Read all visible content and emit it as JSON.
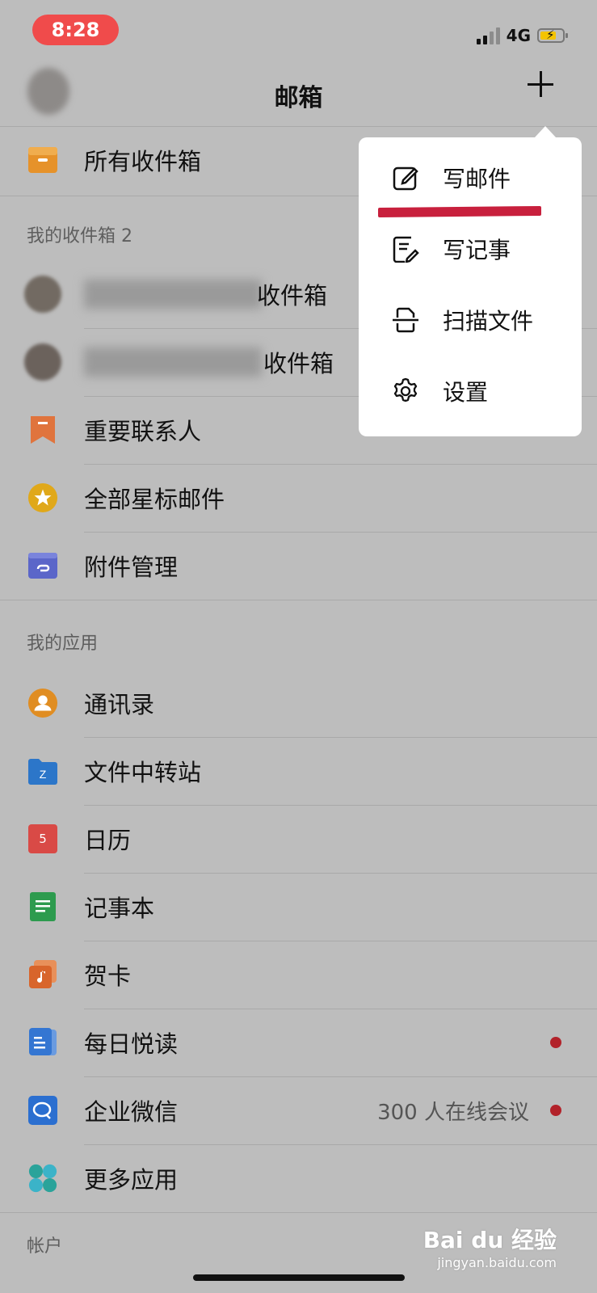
{
  "status": {
    "time": "8:28",
    "network": "4G"
  },
  "header": {
    "title": "邮箱"
  },
  "all_inbox": {
    "label": "所有收件箱"
  },
  "my_inboxes": {
    "section_label": "我的收件箱 2",
    "accounts": [
      {
        "suffix": "收件箱"
      },
      {
        "suffix": "收件箱"
      }
    ]
  },
  "mail_items": [
    {
      "label": "重要联系人"
    },
    {
      "label": "全部星标邮件"
    },
    {
      "label": "附件管理"
    }
  ],
  "apps": {
    "section_label": "我的应用",
    "items": [
      {
        "label": "通讯录"
      },
      {
        "label": "文件中转站"
      },
      {
        "label": "日历",
        "badge": "5"
      },
      {
        "label": "记事本"
      },
      {
        "label": "贺卡"
      },
      {
        "label": "每日悦读"
      },
      {
        "label": "企业微信",
        "extra": "300 人在线会议"
      },
      {
        "label": "更多应用"
      }
    ]
  },
  "account_section": {
    "label": "帐户"
  },
  "popup_menu": [
    {
      "label": "写邮件",
      "icon": "compose-icon"
    },
    {
      "label": "写记事",
      "icon": "note-icon"
    },
    {
      "label": "扫描文件",
      "icon": "scan-icon"
    },
    {
      "label": "设置",
      "icon": "gear-icon"
    }
  ],
  "watermark": {
    "brand": "Bai du 经验",
    "url": "jingyan.baidu.com"
  },
  "colors": {
    "overlay": "#bdbdbd",
    "highlight": "#c8203d",
    "dot": "#b2222a",
    "time_pill": "#f04b4b"
  }
}
